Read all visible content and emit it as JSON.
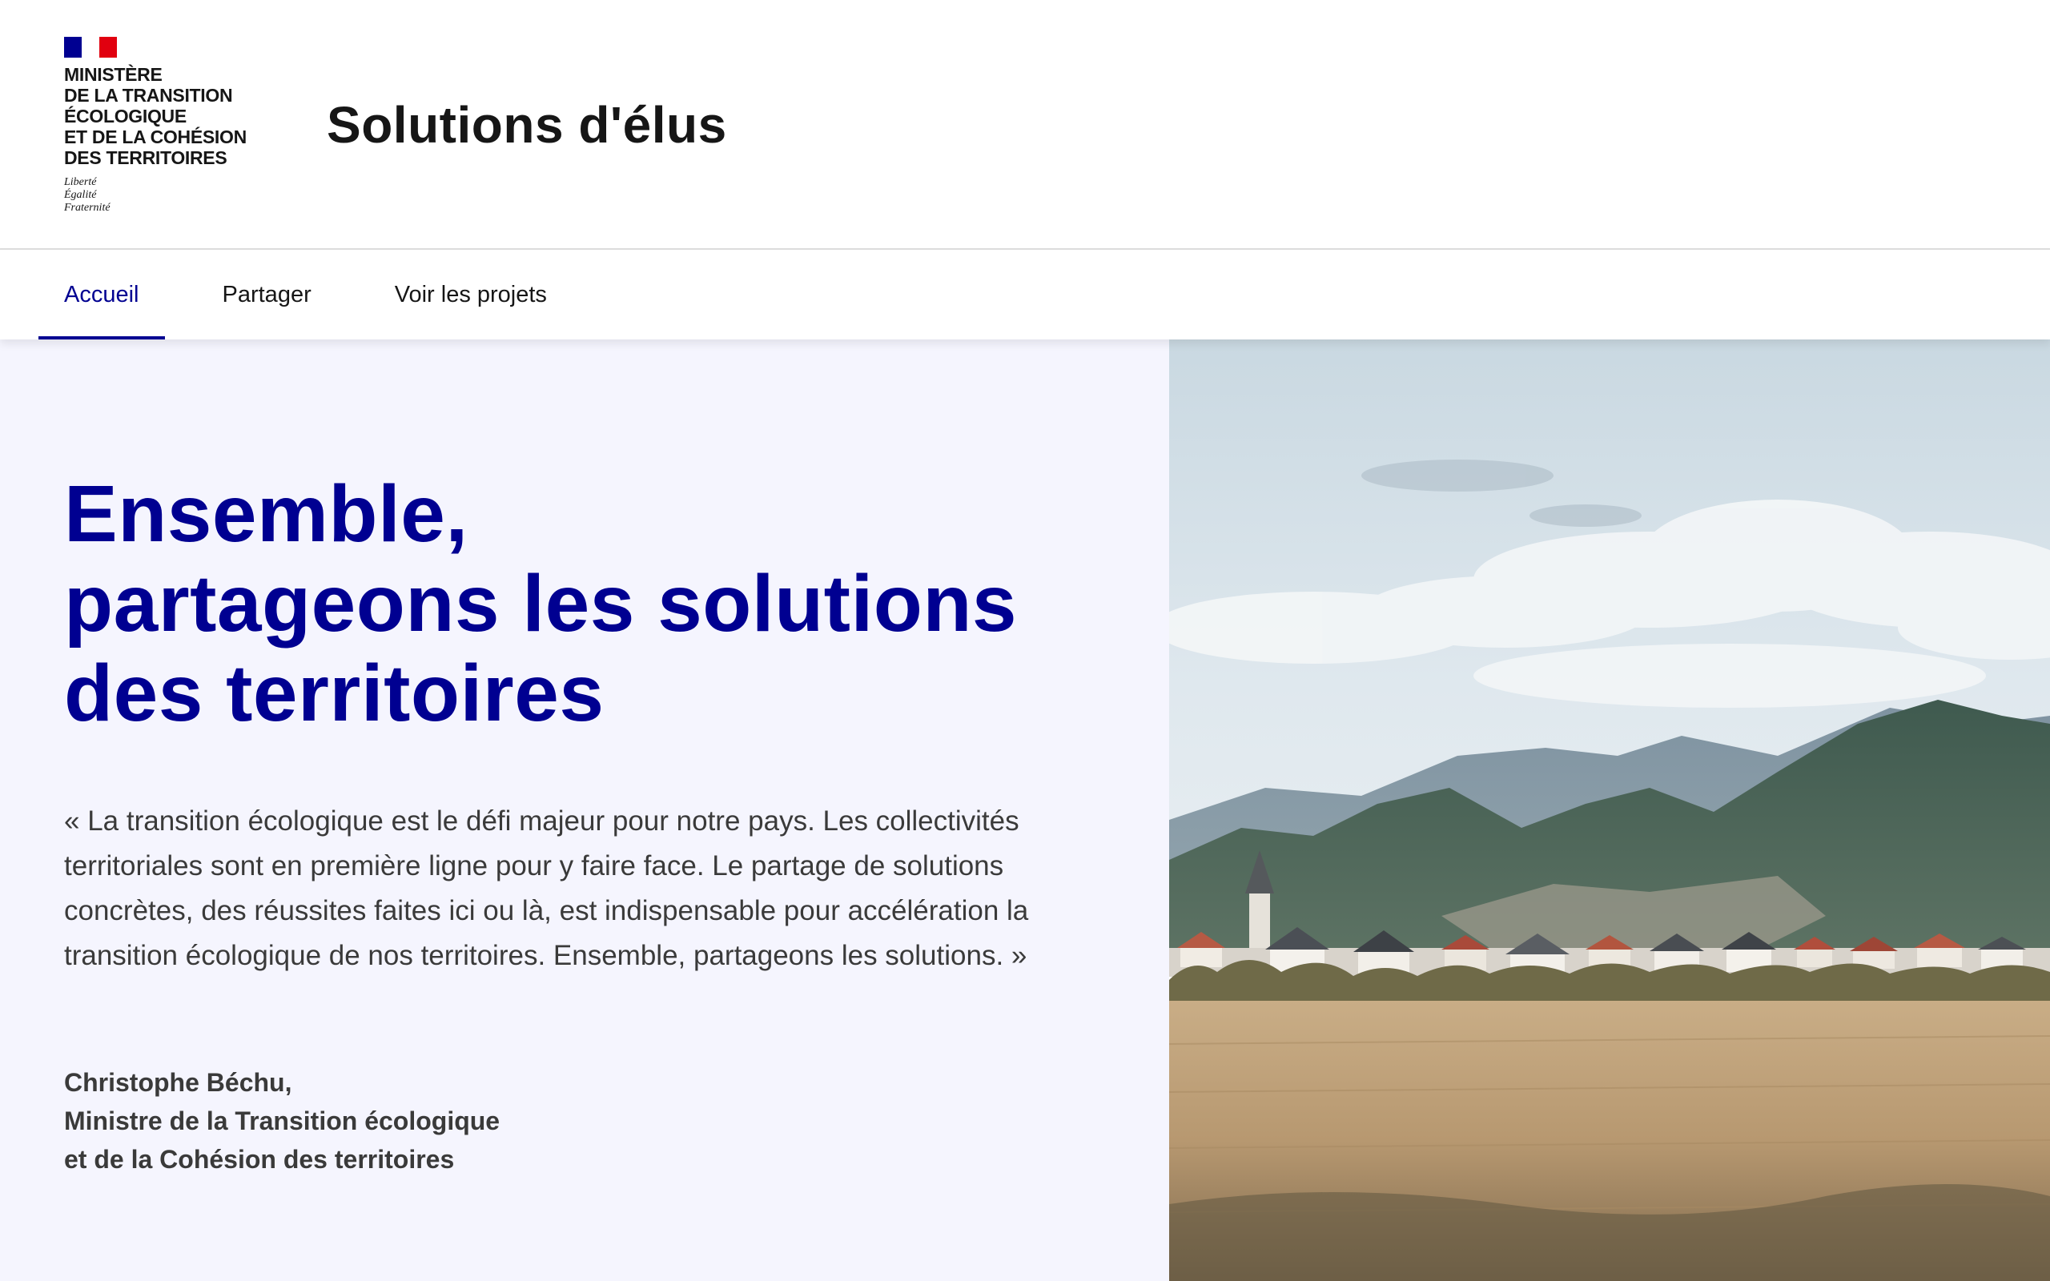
{
  "header": {
    "ministry": "MINISTÈRE\nDE LA TRANSITION\nÉCOLOGIQUE\nET DE LA COHÉSION\nDES TERRITOIRES",
    "motto": "Liberté\nÉgalité\nFraternité",
    "site_title": "Solutions d'élus"
  },
  "nav": {
    "items": [
      {
        "label": "Accueil",
        "active": true
      },
      {
        "label": "Partager",
        "active": false
      },
      {
        "label": "Voir les projets",
        "active": false
      }
    ]
  },
  "hero": {
    "title": "Ensemble,\npartageons les solutions\ndes territoires",
    "quote": "« La transition écologique est le défi majeur pour notre pays. Les collectivités territoriales sont en première ligne pour y faire face. Le partage de solutions concrètes, des réussites faites ici ou là, est indispensable pour accélération la transition écologique de nos territoires. Ensemble, partageons les solutions. »",
    "author": "Christophe Béchu,\nMinistre de la Transition écologique\net de la Cohésion des territoires"
  },
  "colors": {
    "brand_blue": "#000091",
    "brand_red": "#e1000f",
    "hero_background": "#f5f5fe",
    "text_grey": "#3a3a3a"
  }
}
